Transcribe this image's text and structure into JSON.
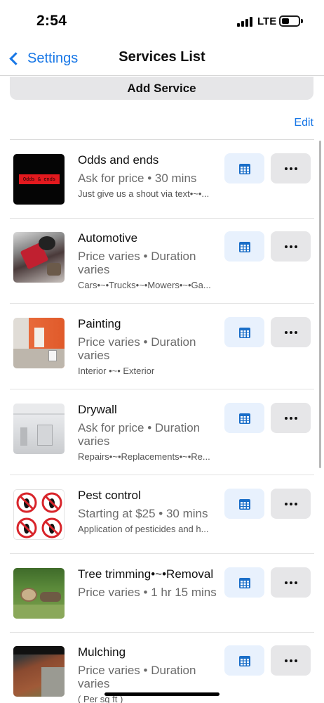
{
  "status_bar": {
    "time": "2:54",
    "network": "LTE"
  },
  "nav": {
    "back_label": "Settings",
    "title": "Services List"
  },
  "actions": {
    "add_service_label": "Add Service",
    "edit_label": "Edit"
  },
  "colors": {
    "accent": "#1877e6",
    "calendar_bg": "#e8f1fd",
    "more_bg": "#e6e6e8"
  },
  "services": [
    {
      "name": "Odds and ends",
      "meta": "Ask for price • 30 mins",
      "description": "Just give us a shout via text•~•...",
      "thumb_text": "Odds & ends",
      "thumb_icon": "odds-and-ends-logo"
    },
    {
      "name": "Automotive",
      "meta": "Price varies • Duration varies",
      "description": "Cars•~•Trucks•~•Mowers•~•Ga...",
      "thumb_icon": "automotive-photo"
    },
    {
      "name": "Painting",
      "meta": "Price varies • Duration varies",
      "description": "Interior •~• Exterior",
      "thumb_icon": "painting-photo"
    },
    {
      "name": "Drywall",
      "meta": "Ask for price • Duration varies",
      "description": "Repairs•~•Replacements•~•Re...",
      "thumb_icon": "drywall-photo"
    },
    {
      "name": "Pest control",
      "meta": "Starting at $25 • 30 mins",
      "description": "Application of pesticides and h...",
      "thumb_icon": "no-bugs-icon"
    },
    {
      "name": "Tree trimming•~•Removal",
      "meta": "Price varies • 1 hr 15 mins",
      "description": "",
      "thumb_icon": "tree-photo"
    },
    {
      "name": "Mulching",
      "meta": "Price varies • Duration varies",
      "description": "( Per sq ft )",
      "thumb_icon": "mulching-photo"
    }
  ],
  "icons": {
    "calendar": "calendar-icon",
    "more": "ellipsis-icon",
    "back": "chevron-left-icon"
  }
}
